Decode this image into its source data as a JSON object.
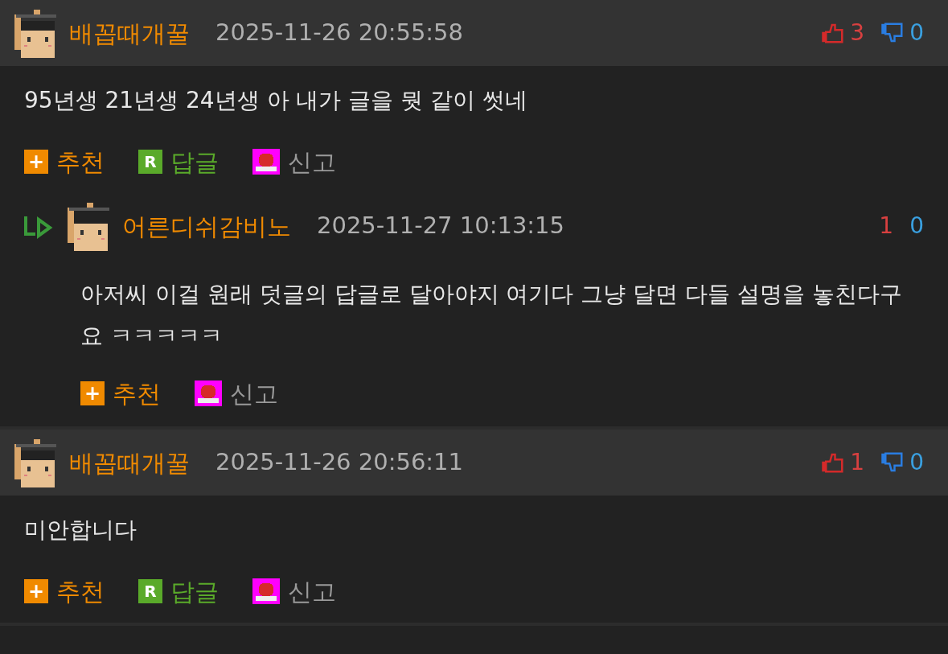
{
  "comments": [
    {
      "author": "배꼽때개꿀",
      "date": "2025-11-26 20:55:58",
      "up": "3",
      "down": "0",
      "text": "95년생 21년생 24년생 아 내가 글을 뭣 같이 썻네",
      "actions": [
        {
          "kind": "recommend",
          "icon": "+",
          "label": "추천"
        },
        {
          "kind": "reply",
          "icon": "R",
          "label": "답글"
        },
        {
          "kind": "report",
          "label": "신고"
        }
      ],
      "replies": [
        {
          "author": "어른디쉬감비노",
          "date": "2025-11-27 10:13:15",
          "up": "1",
          "down": "0",
          "text": "아저씨 이걸 원래 덧글의 답글로 달아야지 여기다 그냥 달면 다들 설명을 놓친다구요 ㅋㅋㅋㅋㅋ",
          "actions": [
            {
              "kind": "recommend",
              "icon": "+",
              "label": "추천"
            },
            {
              "kind": "report",
              "label": "신고"
            }
          ]
        }
      ]
    },
    {
      "author": "배꼽때개꿀",
      "date": "2025-11-26 20:56:11",
      "up": "1",
      "down": "0",
      "text": "미안합니다",
      "actions": [
        {
          "kind": "recommend",
          "icon": "+",
          "label": "추천"
        },
        {
          "kind": "reply",
          "icon": "R",
          "label": "답글"
        },
        {
          "kind": "report",
          "label": "신고"
        }
      ]
    }
  ]
}
